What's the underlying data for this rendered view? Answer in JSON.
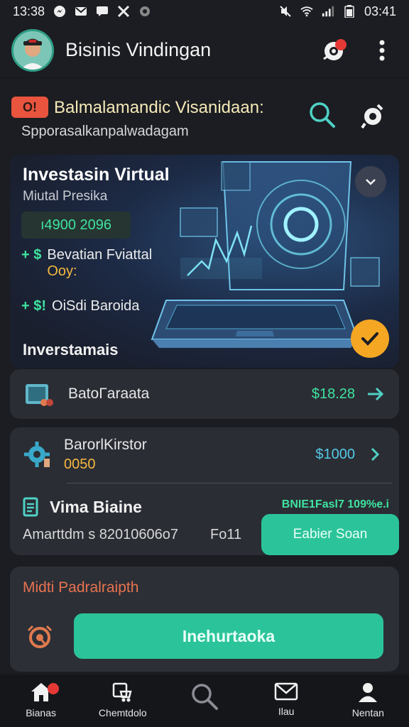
{
  "status": {
    "time": "13:38",
    "clock_right": "03:41"
  },
  "header": {
    "title": "Bisinis Vindingan"
  },
  "search": {
    "alert_chip": "O!",
    "title": "Balmalamandic Visanidaan:",
    "subtitle": "Spporasalkanpalwadagam"
  },
  "hero": {
    "title": "Investasin Virtual",
    "subtitle": "Miutal Presika",
    "amount": "ı4900 2096",
    "bullet1_marker": "+ $",
    "bullet1_line1": "Bevatian Fviattal",
    "bullet1_line2": "Ooy:",
    "bullet2_marker": "+ $!",
    "bullet2_text": "OiSdi Baroida",
    "section_label": "Inverstamais"
  },
  "items": [
    {
      "label": "BatoΓaraata",
      "value": "$18.28"
    },
    {
      "label": "BarorlKirstor",
      "sublabel": "0050",
      "value": "$1000"
    }
  ],
  "vima": {
    "title": "Vima Biaine",
    "badge": "BNIE1Fasl7 109%e.i",
    "detail": "Amarttdm s 82010606o7",
    "detail_right": "Fo11",
    "button": "Eabier Soan"
  },
  "promo": {
    "label": "Midti Padralraipth",
    "button": "Inehurtaoka"
  },
  "nav": [
    {
      "label": "Bianas"
    },
    {
      "label": "Chemtdolo"
    },
    {
      "label": ""
    },
    {
      "label": "Ilau"
    },
    {
      "label": "Nentan"
    }
  ],
  "colors": {
    "background": "#1b1d22",
    "card": "#2a2d34",
    "accent_green": "#2bc49a",
    "value_green": "#3fe3a0",
    "value_blue": "#56c9e6",
    "warning_orange": "#f5a623",
    "alert_red": "#e53935"
  }
}
